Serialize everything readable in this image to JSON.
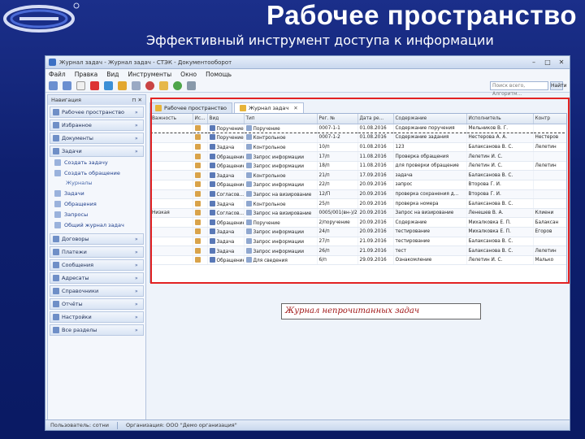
{
  "slide": {
    "title": "Рабочее пространство",
    "subtitle": "Эффективный инструмент доступа к информации"
  },
  "colors": {
    "background": "#0e1f6e",
    "accent": "#3a6fc4",
    "highlight": "#e22222"
  },
  "window": {
    "title": "Журнал задач - Журнал задач - СТЭК - Документооборот",
    "menu": [
      "Файл",
      "Правка",
      "Вид",
      "Инструменты",
      "Окно",
      "Помощь"
    ],
    "search_placeholder": "Поиск всего, Алгоритм...",
    "search_button": "Найти"
  },
  "nav": {
    "header": "Навигация",
    "pin": "⊓ ✕",
    "sections_top": [
      {
        "label": "Рабочее пространство",
        "icon": "workspace-icon"
      },
      {
        "label": "Избранное",
        "icon": "favorites-icon"
      },
      {
        "label": "Документы",
        "icon": "documents-icon"
      },
      {
        "label": "Задачи",
        "icon": "tasks-icon"
      }
    ],
    "task_items": [
      {
        "label": "Создать задачу",
        "icon": "create-task-icon"
      },
      {
        "label": "Создать обращение",
        "icon": "create-request-icon"
      }
    ],
    "group_label": "Журналы",
    "journal_items": [
      {
        "label": "Задачи",
        "icon": "journal-tasks-icon"
      },
      {
        "label": "Обращения",
        "icon": "journal-requests-icon"
      },
      {
        "label": "Запросы",
        "icon": "journal-queries-icon"
      },
      {
        "label": "Общий журнал задач",
        "icon": "journal-general-icon"
      }
    ],
    "sections_bottom": [
      {
        "label": "Договоры",
        "icon": "contracts-icon"
      },
      {
        "label": "Платежи",
        "icon": "payments-icon"
      },
      {
        "label": "Сообщения",
        "icon": "messages-icon"
      },
      {
        "label": "Адресаты",
        "icon": "addressees-icon"
      },
      {
        "label": "Справочники",
        "icon": "directories-icon"
      },
      {
        "label": "Отчёты",
        "icon": "reports-icon"
      },
      {
        "label": "Настройки",
        "icon": "settings-icon"
      },
      {
        "label": "Все разделы",
        "icon": "all-sections-icon"
      }
    ]
  },
  "tabs": [
    {
      "label": "Рабочее пространство",
      "close": ""
    },
    {
      "label": "Журнал задач",
      "close": "✕"
    }
  ],
  "grid": {
    "columns": [
      "Важность",
      "Ис...",
      "Вид",
      "Тип",
      "Рег. №",
      "Дата ре...",
      "Содержание",
      "Исполнитель",
      "Контр"
    ],
    "rows": [
      [
        "",
        "",
        "Поручение",
        "Поручение",
        "0007-1-1",
        "01.08.2016",
        "Содержание поручения",
        "Мельников В. Г.",
        ""
      ],
      [
        "",
        "",
        "Поручение",
        "Контрольное",
        "0007-1-2",
        "01.08.2016",
        "Содержание задания",
        "Нестерова А. А.",
        "Нестеров"
      ],
      [
        "",
        "",
        "Задача",
        "Контрольное",
        "10/п",
        "01.08.2016",
        "123",
        "Балаксанова В. С.",
        "Лелетин"
      ],
      [
        "",
        "",
        "Обращение",
        "Запрос информации",
        "17/п",
        "11.08.2016",
        "Проверка обращения",
        "Лелетин И. С.",
        ""
      ],
      [
        "",
        "",
        "Обращение",
        "Запрос информации",
        "18/п",
        "11.08.2016",
        "для проверки обращение",
        "Лелетин И. С.",
        "Лелетин"
      ],
      [
        "",
        "",
        "Задача",
        "Контрольное",
        "21/п",
        "17.09.2016",
        "задача",
        "Балаксанова В. С.",
        ""
      ],
      [
        "",
        "",
        "Обращение",
        "Запрос информации",
        "22/п",
        "20.09.2016",
        "запрос",
        "Второва Г. И.",
        ""
      ],
      [
        "",
        "",
        "Согласов...",
        "Запрос на визирование",
        "12/П",
        "20.09.2016",
        "проверка сохранения д...",
        "Второва Г. И.",
        ""
      ],
      [
        "",
        "",
        "Задача",
        "Контрольное",
        "25/п",
        "20.09.2016",
        "проверка номера",
        "Балаксанова В. С.",
        ""
      ],
      [
        "Низкая",
        "",
        "Согласов...",
        "Запрос на визирование",
        "0005/001(вн-)/2",
        "20.09.2016",
        "Запрос на визирование",
        "Ленешев В. А.",
        "Клиени"
      ],
      [
        "",
        "",
        "Обращение",
        "Поручение",
        "2/поручение",
        "20.09.2016",
        "Содержание",
        "Михалковка Е. П.",
        "Балаксан"
      ],
      [
        "",
        "",
        "Задача",
        "Запрос информации",
        "24/п",
        "20.09.2016",
        "тестирование",
        "Михалковка Е. П.",
        "Егоров"
      ],
      [
        "",
        "",
        "Задача",
        "Запрос информации",
        "27/п",
        "21.09.2016",
        "тестирование",
        "Балаксанова В. С.",
        ""
      ],
      [
        "",
        "",
        "Задача",
        "Запрос информации",
        "26/п",
        "21.09.2016",
        "тест",
        "Балаксанова В. С.",
        "Лелетин"
      ],
      [
        "",
        "",
        "Обращение",
        "Для сведения",
        "6/п",
        "29.09.2016",
        "Ознакомление",
        "Лелетин И. С.",
        "Малько"
      ]
    ]
  },
  "caption": "Журнал непрочитанных задач",
  "status": {
    "user": "Пользователь: сотни",
    "org": "Организация: ООО \"Демо организация\""
  }
}
